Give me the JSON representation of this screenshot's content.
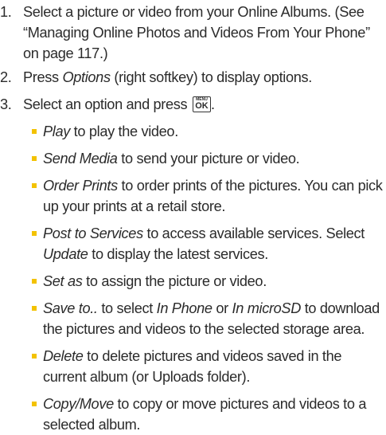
{
  "steps": [
    {
      "number": "1.",
      "text": "Select a picture or video from your Online Albums. (See “Managing Online Photos and Videos From Your Phone” on page 117.)"
    },
    {
      "number": "2.",
      "lead": "Press ",
      "term": "Options",
      "text": " (right softkey) to display options."
    },
    {
      "number": "3.",
      "text": "Select an option and press "
    }
  ],
  "ok_key": {
    "top_label": "MENU",
    "label": "OK"
  },
  "options": [
    {
      "term": "Play",
      "text": " to play the video."
    },
    {
      "term": "Send Media",
      "text": " to send your picture or video."
    },
    {
      "term": "Order Prints",
      "text": " to order prints of the pictures. You can pick up your prints at a retail store."
    },
    {
      "term": "Post to Services",
      "text": " to access available services. Select ",
      "term2": "Update",
      "text2": " to display the latest services."
    },
    {
      "term": "Set as",
      "text": " to assign the picture or video."
    },
    {
      "term": "Save to..",
      "text": " to select ",
      "term2": "In Phone",
      "text2": " or ",
      "term3": "In microSD",
      "text3": " to download the pictures and videos to the selected storage area."
    },
    {
      "term": "Delete",
      "text": " to delete pictures and videos saved in the current album (or Uploads folder)."
    },
    {
      "term": "Copy/Move",
      "text": " to copy or move pictures and videos to a selected album."
    }
  ],
  "colors": {
    "bullet": "#f3c200",
    "text": "#2b2b2b"
  }
}
